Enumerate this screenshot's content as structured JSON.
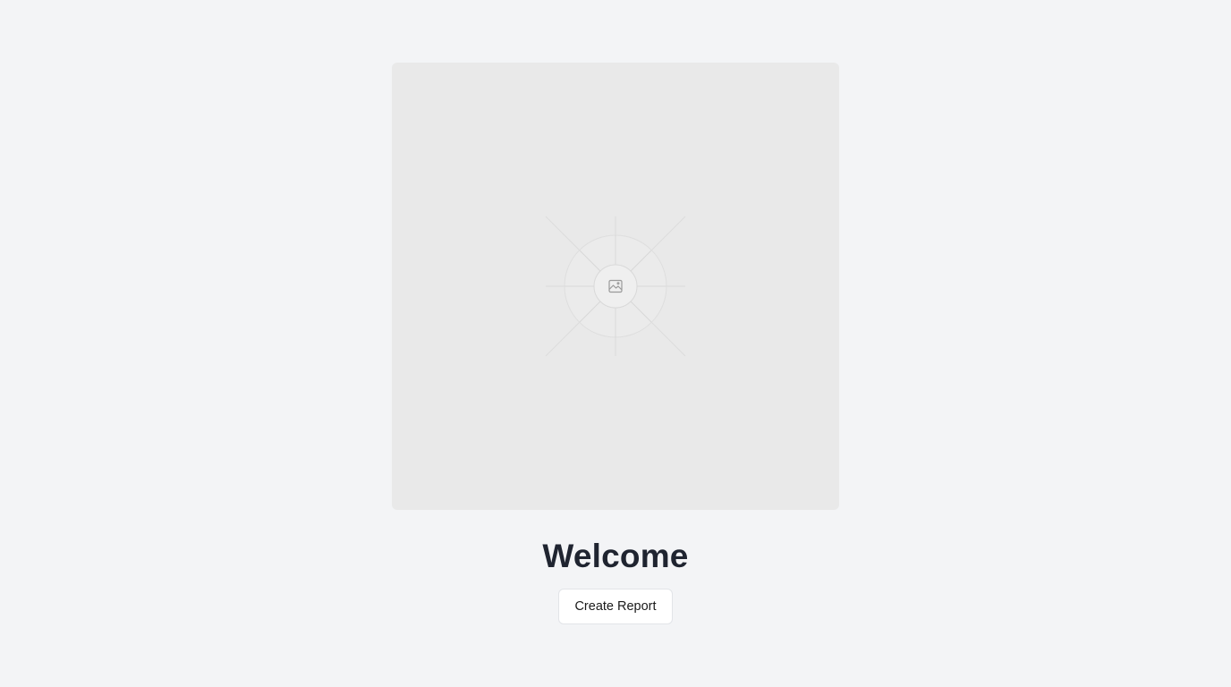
{
  "hero": {
    "image_icon": "image-icon"
  },
  "main": {
    "title": "Welcome",
    "create_report_label": "Create Report"
  },
  "colors": {
    "background": "#f3f4f6",
    "placeholder": "#e9e9e9",
    "title": "#1f2430",
    "button_bg": "#ffffff",
    "button_border": "#e2e4e8"
  }
}
